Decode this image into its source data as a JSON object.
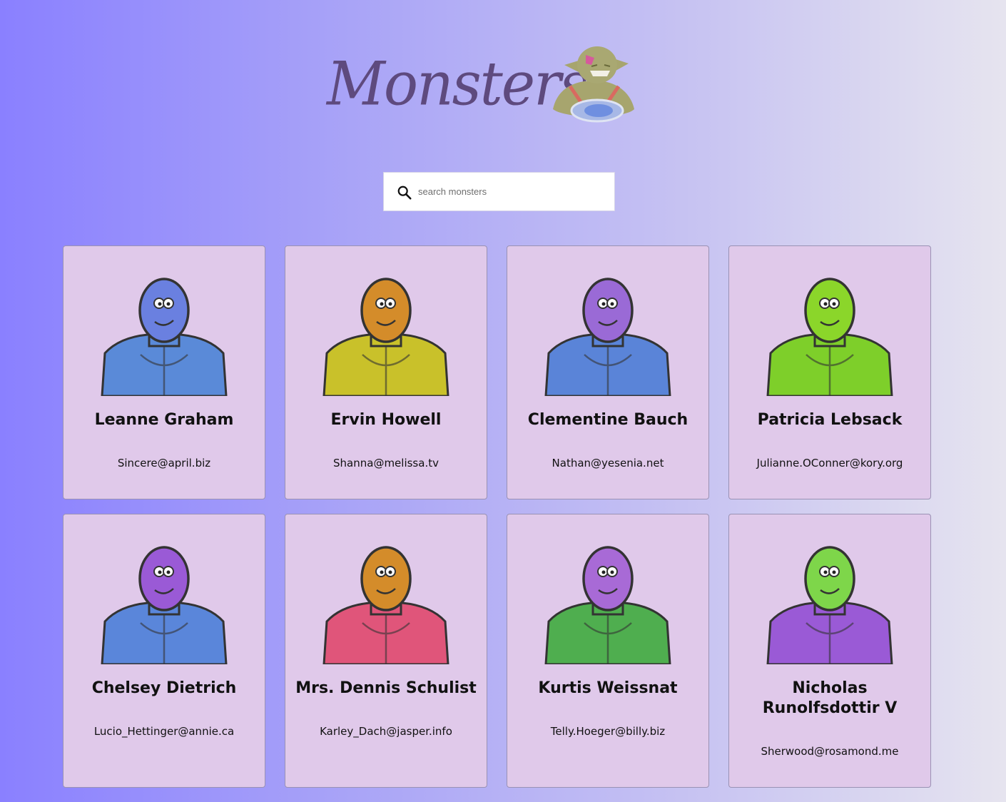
{
  "header": {
    "title": "Monsters",
    "logo_icon": "ogre-logo-icon"
  },
  "search": {
    "placeholder": "search monsters",
    "value": "",
    "icon": "search-icon"
  },
  "monsters": [
    {
      "name": "Leanne Graham",
      "email": "Sincere@april.biz",
      "color": "#5a8ad8"
    },
    {
      "name": "Ervin Howell",
      "email": "Shanna@melissa.tv",
      "color": "#c9c12a"
    },
    {
      "name": "Clementine Bauch",
      "email": "Nathan@yesenia.net",
      "color": "#5a84d8"
    },
    {
      "name": "Patricia Lebsack",
      "email": "Julianne.OConner@kory.org",
      "color": "#7ecf2a"
    },
    {
      "name": "Chelsey Dietrich",
      "email": "Lucio_Hettinger@annie.ca",
      "color": "#5a86da"
    },
    {
      "name": "Mrs. Dennis Schulist",
      "email": "Karley_Dach@jasper.info",
      "color": "#e0557a"
    },
    {
      "name": "Kurtis Weissnat",
      "email": "Telly.Hoeger@billy.biz",
      "color": "#4fae4f"
    },
    {
      "name": "Nicholas Runolfsdottir V",
      "email": "Sherwood@rosamond.me",
      "color": "#9a5ad6"
    }
  ]
}
